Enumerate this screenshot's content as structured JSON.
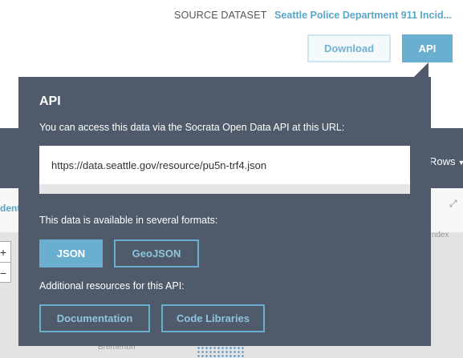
{
  "header": {
    "source_label": "SOURCE DATASET",
    "source_link": "Seattle Police Department 911 Incid...",
    "download_label": "Download",
    "api_label": "API"
  },
  "background": {
    "rows_label": "Rows",
    "left_tab_fragment": "dent",
    "map_labels": [
      "Index",
      "Bremerton"
    ]
  },
  "popup": {
    "title": "API",
    "description": "You can access this data via the Socrata Open Data API at this URL:",
    "url": "https://data.seattle.gov/resource/pu5n-trf4.json",
    "formats_label": "This data is available in several formats:",
    "formats": [
      "JSON",
      "GeoJSON"
    ],
    "resources_label": "Additional resources for this API:",
    "resources": [
      "Documentation",
      "Code Libraries"
    ]
  },
  "colors": {
    "popup_bg": "#4f5a6a",
    "accent": "#6aaed0",
    "link": "#5aa6c8"
  },
  "icons": {
    "rows_caret": "caret-down-icon",
    "expand": "expand-icon"
  }
}
